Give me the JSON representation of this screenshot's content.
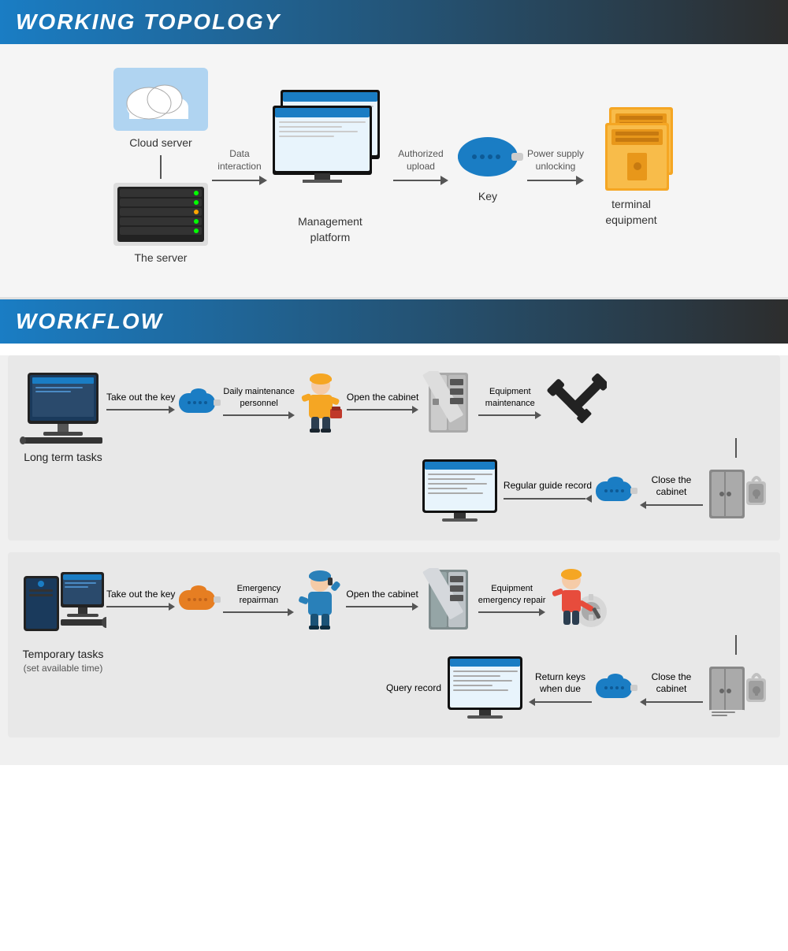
{
  "topology": {
    "header": "WORKING TOPOLOGY",
    "items": [
      {
        "id": "cloud-server",
        "label": "Cloud server",
        "type": "cloud"
      },
      {
        "id": "the-server",
        "label": "The server",
        "type": "server"
      },
      {
        "id": "data-interaction",
        "label": "Data\ninteraction",
        "type": "arrow"
      },
      {
        "id": "management-platform",
        "label": "Management\nplatform",
        "type": "monitor-double"
      },
      {
        "id": "authorized-upload",
        "label": "Authorized\nupload",
        "type": "arrow"
      },
      {
        "id": "key",
        "label": "Key",
        "type": "key"
      },
      {
        "id": "power-supply-unlocking",
        "label": "Power supply\nunlocking",
        "type": "arrow"
      },
      {
        "id": "terminal-equipment",
        "label": "terminal\nequipment",
        "type": "cabinet-double"
      }
    ]
  },
  "workflow": {
    "header": "WORKFLOW",
    "blocks": [
      {
        "id": "long-term",
        "task_label": "Long term tasks",
        "task_sub": "",
        "top_row": [
          {
            "type": "pc",
            "label": ""
          },
          {
            "arrow": "Take out the key"
          },
          {
            "type": "key-blue",
            "label": ""
          },
          {
            "arrow": "Daily maintenance\npersonnel"
          },
          {
            "type": "worker-yellow",
            "label": ""
          },
          {
            "arrow": "Open the cabinet"
          },
          {
            "type": "cabinet-open",
            "label": ""
          },
          {
            "arrow": "Equipment\nmaintenance"
          },
          {
            "type": "tools",
            "label": ""
          }
        ],
        "bottom_row": [
          {
            "type": "monitor-wf",
            "label": ""
          },
          {
            "arrow_left": "Regular guide record"
          },
          {
            "type": "key-blue-2",
            "label": ""
          },
          {
            "arrow_left": ""
          },
          {
            "type": "lock-cabinet",
            "label": ""
          },
          {
            "arrow_left": "Close the\ncabinet"
          }
        ]
      },
      {
        "id": "temporary",
        "task_label": "Temporary tasks",
        "task_sub": "(set available time)",
        "top_row": [
          {
            "type": "pc2",
            "label": ""
          },
          {
            "arrow": "Take out the key"
          },
          {
            "type": "key-orange",
            "label": ""
          },
          {
            "arrow": "Emergency\nrepairman"
          },
          {
            "type": "worker-blue",
            "label": ""
          },
          {
            "arrow": "Open the cabinet"
          },
          {
            "type": "cabinet-open2",
            "label": ""
          },
          {
            "arrow": "Equipment\nemergency repair"
          },
          {
            "type": "repair-person",
            "label": ""
          }
        ],
        "bottom_row": [
          {
            "type": "monitor-wf2",
            "label": ""
          },
          {
            "arrow_left": "Query record"
          },
          {
            "type": "key-blue-3",
            "label": ""
          },
          {
            "arrow_left": ""
          },
          {
            "type": "lock-cabinet2",
            "label": ""
          },
          {
            "arrow_left": "Close the\ncabinet"
          },
          {
            "arrow_label": "Return keys\nwhen due"
          }
        ]
      }
    ]
  }
}
